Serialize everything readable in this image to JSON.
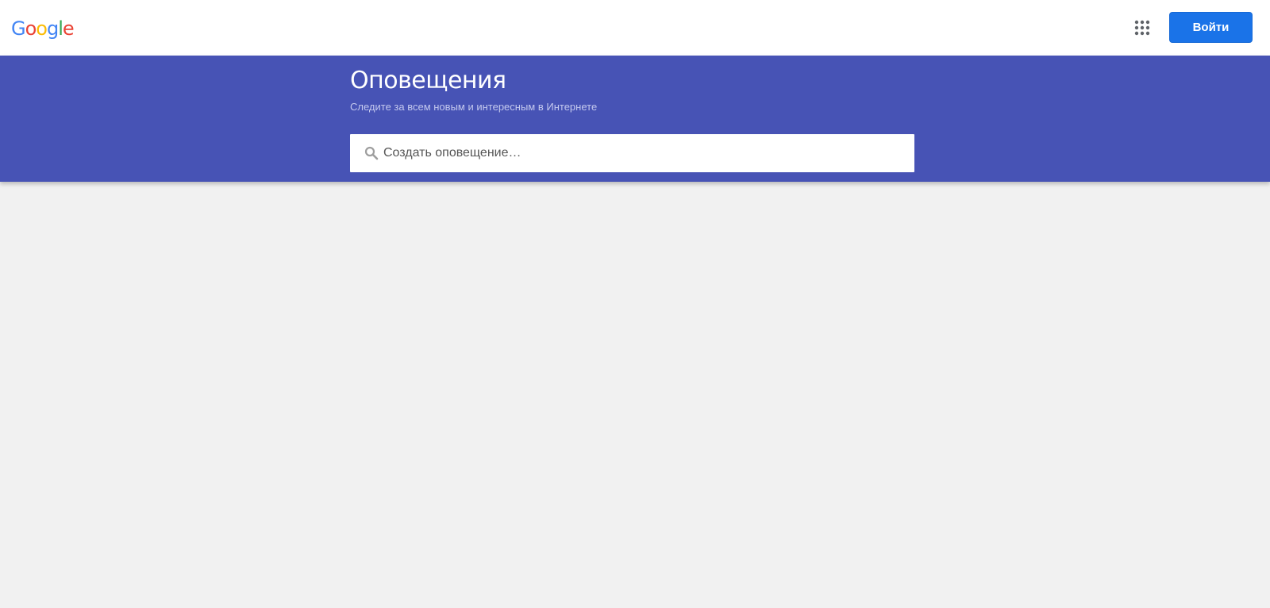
{
  "header": {
    "logo": {
      "letters": [
        "G",
        "o",
        "o",
        "g",
        "l",
        "e"
      ],
      "colors": [
        "#4285f4",
        "#ea4335",
        "#fbbc05",
        "#4285f4",
        "#34a853",
        "#ea4335"
      ]
    },
    "apps_icon": "apps-grid-icon",
    "signin_label": "Войти"
  },
  "banner": {
    "title": "Оповещения",
    "subtitle": "Следите за всем новым и интересным в Интернете",
    "background_color": "#4753b5"
  },
  "search": {
    "icon": "search-icon",
    "placeholder": "Создать оповещение…",
    "value": ""
  },
  "colors": {
    "accent": "#1a73e8",
    "page_background": "#f1f1f1"
  }
}
